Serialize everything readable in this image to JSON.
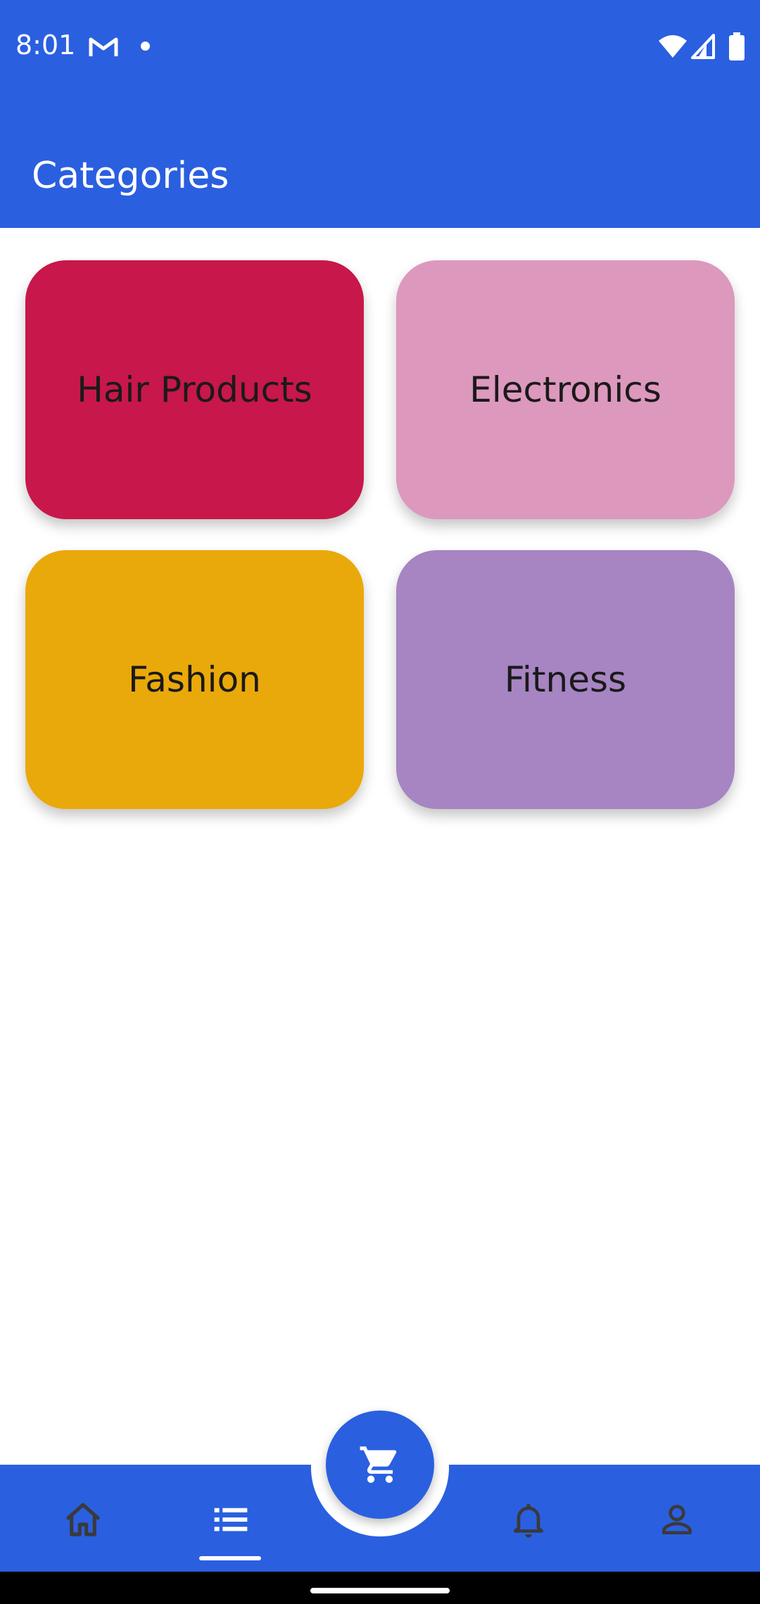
{
  "status_bar": {
    "time": "8:01",
    "notification_icons": [
      "gmail-icon",
      "dot-icon"
    ],
    "system_icons": [
      "wifi-icon",
      "signal-icon",
      "battery-icon"
    ]
  },
  "app_bar": {
    "title": "Categories"
  },
  "categories": [
    {
      "label": "Hair Products",
      "color": "#c8174a"
    },
    {
      "label": "Electronics",
      "color": "#dd98bd"
    },
    {
      "label": "Fashion",
      "color": "#eaa90a"
    },
    {
      "label": "Fitness",
      "color": "#a685c2"
    }
  ],
  "bottom_nav": {
    "items": [
      {
        "icon": "home-icon",
        "active": false
      },
      {
        "icon": "list-icon",
        "active": true
      },
      {
        "icon": "bell-icon",
        "active": false
      },
      {
        "icon": "person-icon",
        "active": false
      }
    ],
    "fab_icon": "cart-icon"
  },
  "colors": {
    "primary": "#2a5fe0",
    "nav_icon_inactive": "#3a3a3a",
    "nav_icon_active": "#ffffff"
  }
}
